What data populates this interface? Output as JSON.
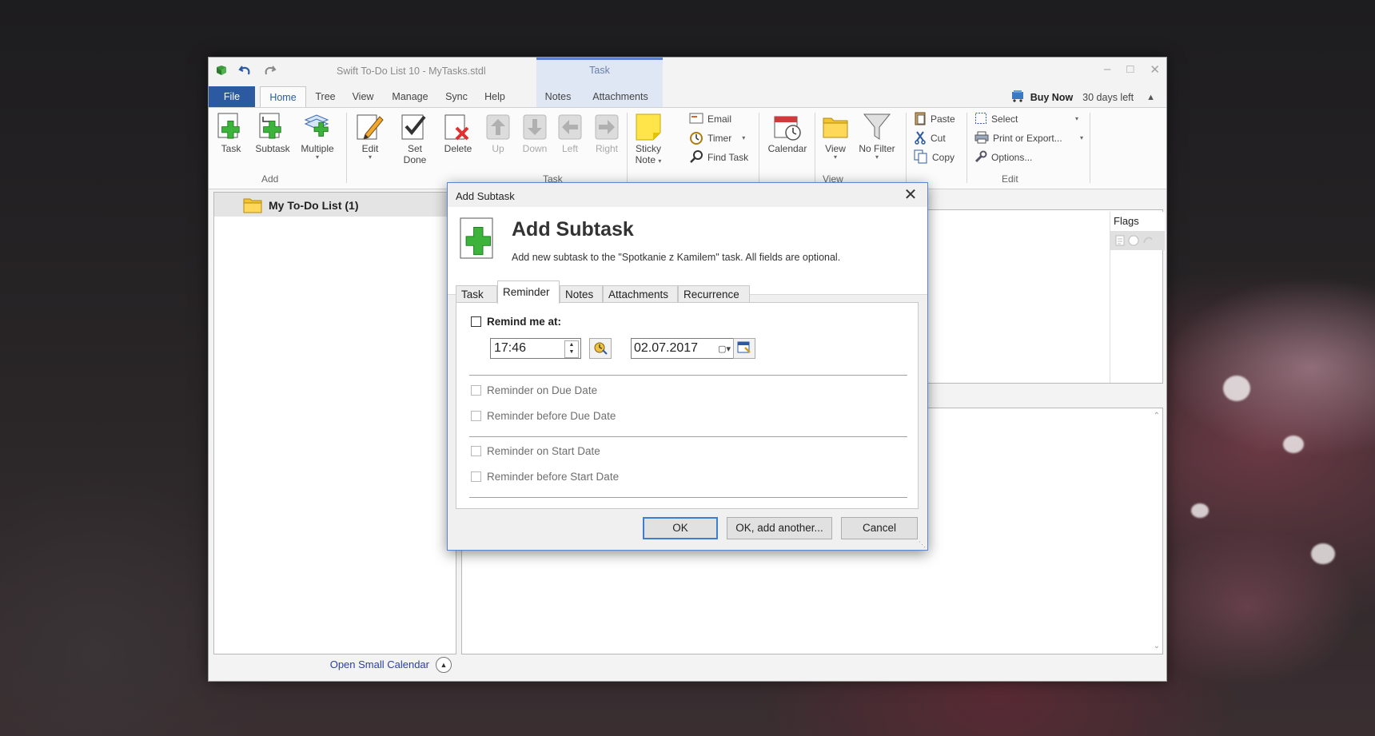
{
  "window": {
    "title": "Swift To-Do List 10 - MyTasks.stdl",
    "context_tab_group": "Task",
    "buy_now": "Buy Now",
    "days_left": "30 days left"
  },
  "ribbon_tabs": [
    "File",
    "Home",
    "Tree",
    "View",
    "Manage",
    "Sync",
    "Help",
    "Notes",
    "Attachments"
  ],
  "ribbon": {
    "add_group": "Add",
    "task_group": "Task",
    "view_group": "View",
    "edit_group": "Edit",
    "task": "Task",
    "subtask": "Subtask",
    "multiple": "Multiple",
    "edit": "Edit",
    "set": "Set",
    "done": "Done",
    "delete": "Delete",
    "up": "Up",
    "down": "Down",
    "left": "Left",
    "right": "Right",
    "sticky": "Sticky",
    "note": "Note",
    "email": "Email",
    "timer": "Timer",
    "find_task": "Find Task",
    "calendar": "Calendar",
    "view": "View",
    "no_filter": "No Filter",
    "paste": "Paste",
    "cut": "Cut",
    "copy": "Copy",
    "select": "Select",
    "print_export": "Print or Export...",
    "options": "Options..."
  },
  "left_pane": {
    "list_title": "My To-Do List (1)",
    "calendar_link": "Open Small Calendar"
  },
  "grid": {
    "flags_header": "Flags"
  },
  "dialog": {
    "title": "Add Subtask",
    "heading": "Add Subtask",
    "subtitle": "Add new subtask to the \"Spotkanie z Kamilem\" task. All fields are optional.",
    "tabs": [
      "Task",
      "Reminder",
      "Notes",
      "Attachments",
      "Recurrence"
    ],
    "active_tab": "Reminder",
    "remind_label": "Remind me at:",
    "remind_checked": false,
    "time": "17:46",
    "date": "02.07.2017",
    "options": [
      "Reminder on Due Date",
      "Reminder before Due Date",
      "Reminder on Start Date",
      "Reminder before Start Date"
    ],
    "ok": "OK",
    "ok_another": "OK, add another...",
    "cancel": "Cancel"
  },
  "colors": {
    "accent": "#2c5aa0",
    "context_tab": "#dfe7f5",
    "link": "#2b3ea8",
    "green_plus": "#3cb43c"
  },
  "icons": [
    "save-icon",
    "undo-icon",
    "redo-icon",
    "plus-icon",
    "pencil-icon",
    "checkmark-icon",
    "delete-icon",
    "arrow-up-icon",
    "arrow-down-icon",
    "arrow-left-icon",
    "arrow-right-icon",
    "sticky-note-icon",
    "email-icon",
    "timer-icon",
    "find-icon",
    "calendar-icon",
    "folder-icon",
    "filter-icon",
    "paste-icon",
    "cut-icon",
    "copy-icon",
    "select-icon",
    "print-icon",
    "options-icon",
    "close-icon"
  ]
}
